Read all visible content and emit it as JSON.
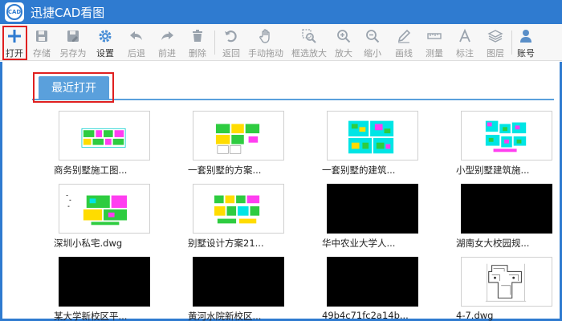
{
  "window": {
    "title": "迅捷CAD看图",
    "logo_text": "CAD"
  },
  "toolbar": {
    "open": "打开",
    "save": "存储",
    "save_as": "另存为",
    "settings": "设置",
    "back": "后退",
    "forward": "前进",
    "delete": "删除",
    "return": "返回",
    "pan": "手动拖动",
    "zoom_box": "框选放大",
    "zoom_in": "放大",
    "zoom_out": "缩小",
    "draw_line": "画线",
    "measure": "测量",
    "annotate": "标注",
    "layers": "图层",
    "account": "账号"
  },
  "recent": {
    "tab_label": "最近打开",
    "files": [
      {
        "name": "商务别墅施工图...",
        "thumb": "green"
      },
      {
        "name": "一套别墅的方案...",
        "thumb": "green"
      },
      {
        "name": "一套别墅的建筑...",
        "thumb": "cyan"
      },
      {
        "name": "小型别墅建筑施...",
        "thumb": "cyan"
      },
      {
        "name": "深圳小私宅.dwg",
        "thumb": "green"
      },
      {
        "name": "别墅设计方案21...",
        "thumb": "green"
      },
      {
        "name": "华中农业大学人...",
        "thumb": "dark"
      },
      {
        "name": "湖南女大校园规...",
        "thumb": "dark"
      },
      {
        "name": "某大学新校区平...",
        "thumb": "dark"
      },
      {
        "name": "黄河水院新校区...",
        "thumb": "dark"
      },
      {
        "name": "49b4c71fc2a14b...",
        "thumb": "dark"
      },
      {
        "name": "4-7.dwg",
        "thumb": "plan"
      }
    ]
  },
  "colors": {
    "accent": "#2f7bd0",
    "tab": "#5aa0dc",
    "highlight": "#e02020"
  }
}
